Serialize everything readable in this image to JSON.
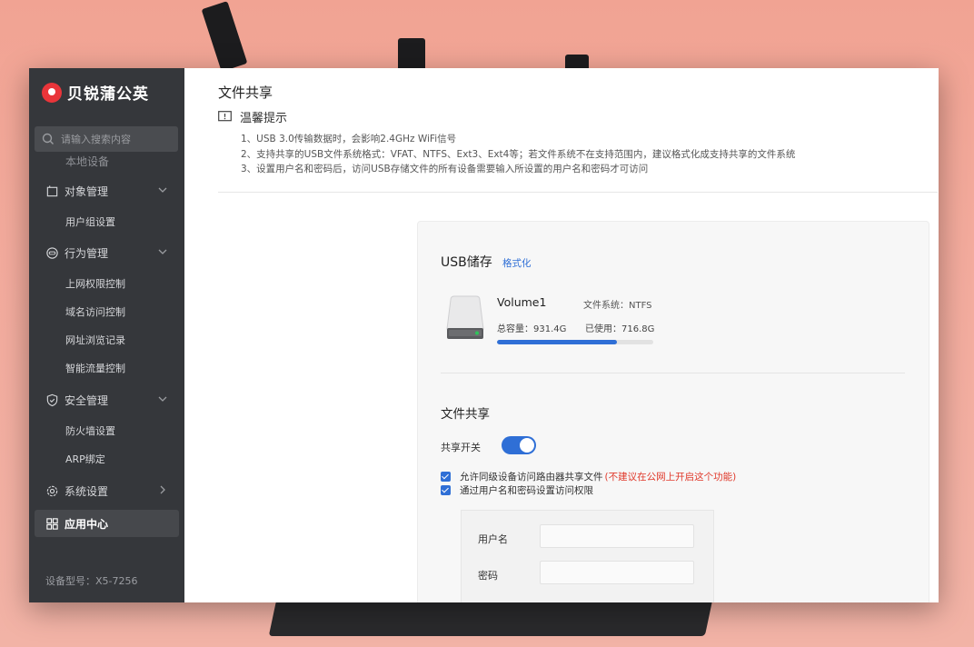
{
  "brand": {
    "name": "贝锐蒲公英"
  },
  "search": {
    "placeholder": "请输入搜索内容"
  },
  "sidebar": {
    "partial_item": "本地设备",
    "groups": [
      {
        "label": "对象管理",
        "icon": "cube-icon",
        "subitems": [
          "用户组设置"
        ]
      },
      {
        "label": "行为管理",
        "icon": "behavior-icon",
        "subitems": [
          "上网权限控制",
          "域名访问控制",
          "网址浏览记录",
          "智能流量控制"
        ]
      },
      {
        "label": "安全管理",
        "icon": "shield-icon",
        "subitems": [
          "防火墙设置",
          "ARP绑定"
        ]
      },
      {
        "label": "系统设置",
        "icon": "gear-icon"
      },
      {
        "label": "应用中心",
        "icon": "grid-icon",
        "active": true
      }
    ],
    "device_model": "设备型号：X5-7256"
  },
  "main": {
    "title": "文件共享",
    "tip": {
      "title": "温馨提示",
      "lines": [
        "1、USB 3.0传输数据时，会影响2.4GHz WiFi信号",
        "2、支持共享的USB文件系统格式：VFAT、NTFS、Ext3、Ext4等；若文件系统不在支持范围内，建议格式化成支持共享的文件系统",
        "3、设置用户名和密码后，访问USB存储文件的所有设备需要输入所设置的用户名和密码才可访问"
      ]
    },
    "usb": {
      "title": "USB储存",
      "format_label": "格式化",
      "volume_name": "Volume1",
      "filesystem": "文件系统：NTFS",
      "capacity": "总容量：931.4G",
      "used": "已使用：716.8G",
      "used_fraction": 0.77
    },
    "share": {
      "title": "文件共享",
      "switch_label": "共享开关",
      "switch_on": true,
      "option1": "允许同级设备访问路由器共享文件",
      "option1_warning": "(不建议在公网上开启这个功能)",
      "option2": "通过用户名和密码设置访问权限",
      "username_label": "用户名",
      "password_label": "密码",
      "username_value": "",
      "password_value": ""
    }
  },
  "colors": {
    "accent": "#2f6fd6",
    "sidebar_bg": "#35373b",
    "brand": "#e9353a",
    "warning": "#e0392b"
  }
}
